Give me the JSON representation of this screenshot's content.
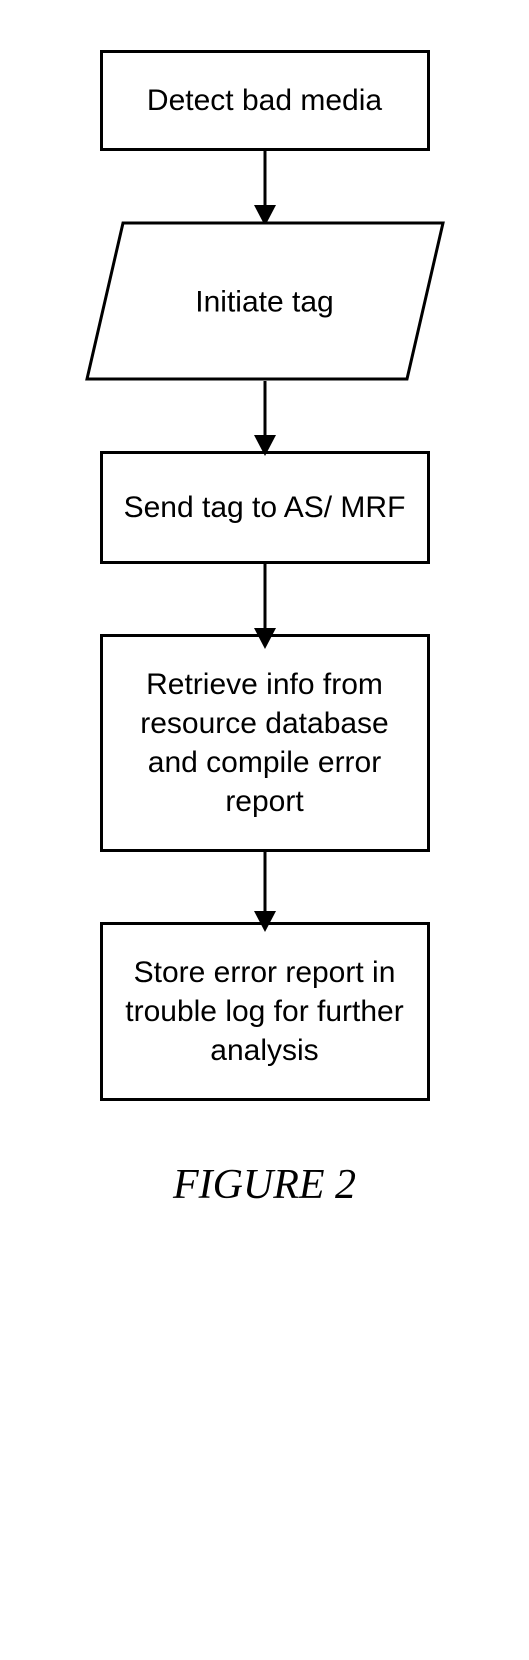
{
  "flowchart": {
    "steps": [
      {
        "type": "process",
        "label": "Detect bad media"
      },
      {
        "type": "data",
        "label": "Initiate tag"
      },
      {
        "type": "process",
        "label": "Send tag to AS/\nMRF"
      },
      {
        "type": "process",
        "label": "Retrieve info from resource database and compile error report"
      },
      {
        "type": "process",
        "label": "Store error report in trouble log for further analysis"
      }
    ]
  },
  "caption": "FIGURE 2"
}
